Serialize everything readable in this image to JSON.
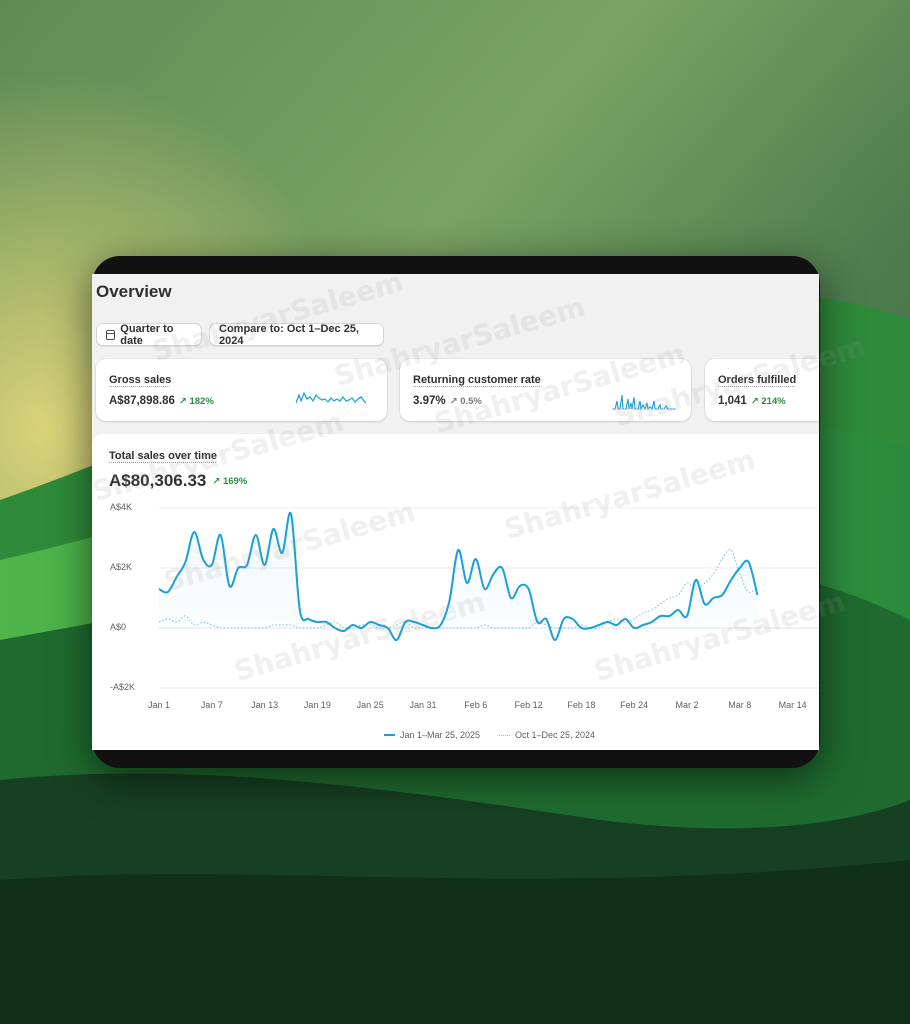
{
  "page": {
    "title": "Overview"
  },
  "filters": {
    "date_range_label": "Quarter to date",
    "compare_label": "Compare to: Oct 1–Dec 25, 2024"
  },
  "metrics": [
    {
      "title": "Gross sales",
      "value": "A$87,898.86",
      "delta": "182%",
      "trend": "up"
    },
    {
      "title": "Returning customer rate",
      "value": "3.97%",
      "delta": "0.5%",
      "trend": "up-neutral"
    },
    {
      "title": "Orders fulfilled",
      "value": "1,041",
      "delta": "214%",
      "trend": "up"
    }
  ],
  "sales_chart": {
    "title": "Total sales over time",
    "value": "A$80,306.33",
    "delta": "169%"
  },
  "watermark": "ShahryarSaleem",
  "colors": {
    "accent_line": "#1aa0d8",
    "compare_line": "#7ec4e6",
    "positive": "#2e8b45",
    "neutral": "#7a7a7a"
  },
  "icons": {
    "date_range": "calendar-icon",
    "trend_up": "arrow-up-right-icon"
  },
  "chart_data": {
    "type": "line",
    "title": "",
    "xlabel": "",
    "ylabel": "",
    "ylim": [
      -2000,
      4000
    ],
    "yticks": [
      "A$4K",
      "A$2K",
      "A$0",
      "-A$2K"
    ],
    "xticks": [
      "Jan 1",
      "Jan 7",
      "Jan 13",
      "Jan 19",
      "Jan 25",
      "Jan 31",
      "Feb 6",
      "Feb 12",
      "Feb 18",
      "Feb 24",
      "Mar 2",
      "Mar 8",
      "Mar 14"
    ],
    "grid": true,
    "legend_position": "bottom",
    "x_start": "Jan 1",
    "series": [
      {
        "name": "Jan 1–Mar 25, 2025",
        "style": "solid",
        "values": [
          1300,
          1200,
          1700,
          2200,
          3200,
          2300,
          2100,
          3100,
          1400,
          2000,
          2100,
          3100,
          2100,
          3300,
          2500,
          3800,
          600,
          300,
          200,
          200,
          0,
          -100,
          100,
          0,
          200,
          100,
          0,
          -400,
          200,
          200,
          100,
          0,
          100,
          900,
          2600,
          1500,
          2300,
          1300,
          1800,
          2000,
          1000,
          1400,
          1300,
          200,
          300,
          -400,
          300,
          300,
          0,
          0,
          100,
          200,
          100,
          300,
          0,
          100,
          200,
          400,
          400,
          600,
          400,
          1600,
          800,
          1000,
          1100,
          1600,
          2000,
          2200,
          1100
        ]
      },
      {
        "name": "Oct 1–Dec 25, 2024",
        "style": "dotted",
        "values": [
          200,
          300,
          200,
          400,
          100,
          200,
          100,
          0,
          0,
          0,
          0,
          0,
          0,
          100,
          100,
          100,
          0,
          0,
          0,
          100,
          200,
          0,
          0,
          100,
          100,
          0,
          0,
          100,
          200,
          0,
          0,
          0,
          0,
          0,
          0,
          0,
          0,
          100,
          0,
          0,
          0,
          0,
          0,
          200,
          100,
          0,
          0,
          0,
          100,
          0,
          0,
          200,
          300,
          200,
          300,
          500,
          600,
          800,
          1000,
          1100,
          1500,
          1300,
          1500,
          1800,
          2300,
          2600,
          1800,
          1200,
          1400
        ]
      }
    ]
  }
}
